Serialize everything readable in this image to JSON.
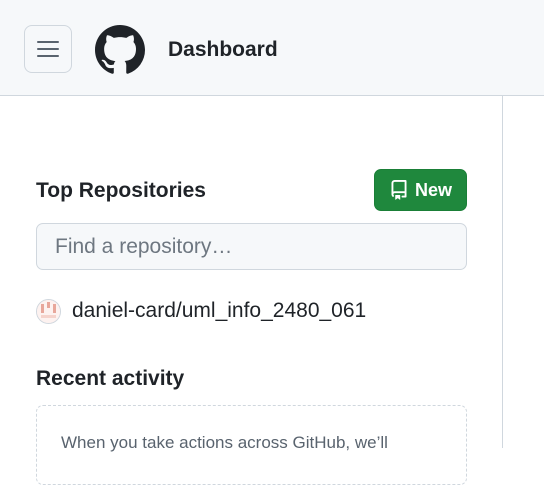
{
  "header": {
    "title": "Dashboard",
    "menu_icon": "hamburger-icon",
    "logo_icon": "github-octocat-icon"
  },
  "top_repositories": {
    "title": "Top Repositories",
    "new_button_label": "New",
    "new_button_icon": "repo-icon",
    "search_placeholder": "Find a repository…",
    "repos": [
      {
        "name": "daniel-card/uml_info_2480_061",
        "avatar_icon": "identicon-avatar"
      }
    ]
  },
  "recent_activity": {
    "title": "Recent activity",
    "empty_text": "When you take actions across GitHub, we’ll"
  },
  "colors": {
    "primary_button": "#1f883d",
    "header_bg": "#f6f8fa",
    "border": "#d0d7de",
    "text": "#1f2328"
  }
}
